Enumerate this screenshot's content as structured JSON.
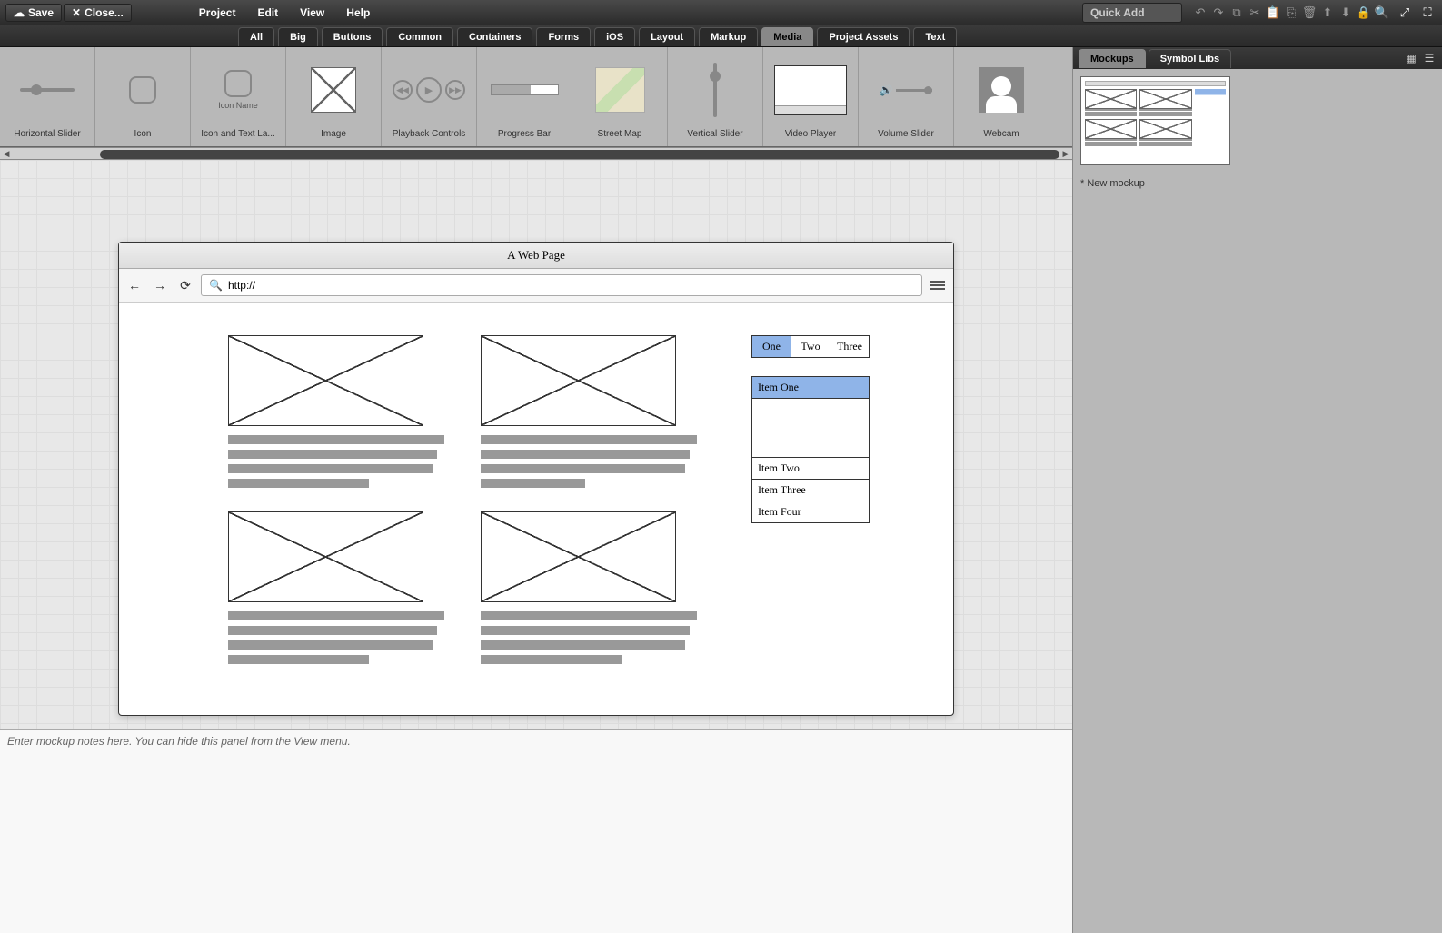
{
  "topbar": {
    "save": "Save",
    "close": "Close...",
    "menus": [
      "Project",
      "Edit",
      "View",
      "Help"
    ],
    "quickadd": "Quick Add"
  },
  "categories": [
    "All",
    "Big",
    "Buttons",
    "Common",
    "Containers",
    "Forms",
    "iOS",
    "Layout",
    "Markup",
    "Media",
    "Project Assets",
    "Text"
  ],
  "categories_active": "Media",
  "widgets": [
    {
      "label": "Horizontal Slider",
      "type": "hslider"
    },
    {
      "label": "Icon",
      "type": "icon"
    },
    {
      "label": "Icon and Text La...",
      "type": "icontext",
      "sublabel": "Icon Name"
    },
    {
      "label": "Image",
      "type": "image"
    },
    {
      "label": "Playback Controls",
      "type": "playback"
    },
    {
      "label": "Progress Bar",
      "type": "progress"
    },
    {
      "label": "Street Map",
      "type": "map"
    },
    {
      "label": "Vertical Slider",
      "type": "vslider"
    },
    {
      "label": "Video Player",
      "type": "video"
    },
    {
      "label": "Volume Slider",
      "type": "volume"
    },
    {
      "label": "Webcam",
      "type": "webcam"
    }
  ],
  "mockup": {
    "window_title": "A Web Page",
    "url": "http://",
    "tabs": [
      "One",
      "Two",
      "Three"
    ],
    "tabs_active": "One",
    "accordion": [
      "Item One",
      "Item Two",
      "Item Three",
      "Item Four"
    ],
    "accordion_active": "Item One"
  },
  "notes_placeholder": "Enter mockup notes here. You can hide this panel from the View menu.",
  "rightpanel": {
    "tabs": [
      "Mockups",
      "Symbol Libs"
    ],
    "tabs_active": "Mockups",
    "mockup_name": "* New mockup"
  }
}
